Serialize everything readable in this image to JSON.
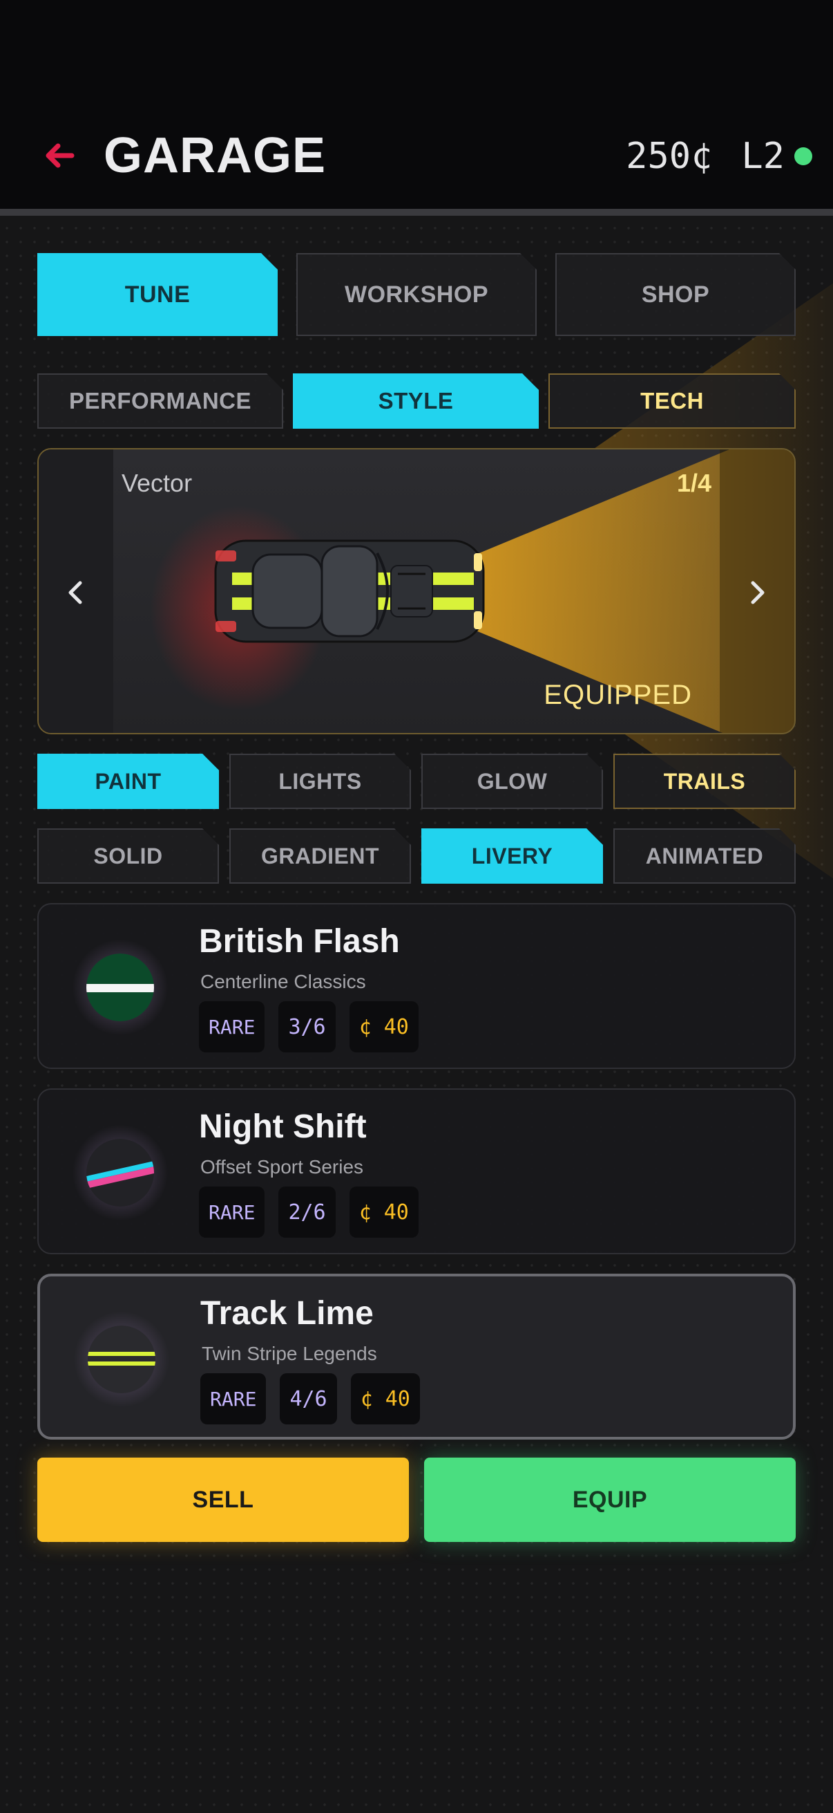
{
  "header": {
    "title": "GARAGE",
    "credits": "250¢",
    "level": "L2",
    "status_color": "#4ade80",
    "back_icon": "arrow-left-icon",
    "accent": "#e11d48"
  },
  "main_tabs": [
    {
      "label": "TUNE",
      "active": true
    },
    {
      "label": "WORKSHOP",
      "active": false
    },
    {
      "label": "SHOP",
      "active": false
    }
  ],
  "sub_tabs": [
    {
      "label": "PERFORMANCE",
      "active": false
    },
    {
      "label": "STYLE",
      "active": true
    },
    {
      "label": "TECH",
      "active": false
    }
  ],
  "preview": {
    "car_name": "Vector",
    "index": "1/4",
    "status": "EQUIPPED",
    "prev_icon": "chevron-left-icon",
    "next_icon": "chevron-right-icon"
  },
  "category_tabs": [
    {
      "label": "PAINT",
      "active": true
    },
    {
      "label": "LIGHTS",
      "active": false
    },
    {
      "label": "GLOW",
      "active": false
    },
    {
      "label": "TRAILS",
      "active": false
    }
  ],
  "pattern_tabs": [
    {
      "label": "SOLID",
      "active": false
    },
    {
      "label": "GRADIENT",
      "active": false
    },
    {
      "label": "LIVERY",
      "active": true
    },
    {
      "label": "ANIMATED",
      "active": false
    }
  ],
  "liveries": [
    {
      "name": "British Flash",
      "series": "Centerline Classics",
      "rarity": "RARE",
      "count": "3/6",
      "price": "¢ 40",
      "selected": false
    },
    {
      "name": "Night Shift",
      "series": "Offset Sport Series",
      "rarity": "RARE",
      "count": "2/6",
      "price": "¢ 40",
      "selected": false
    },
    {
      "name": "Track Lime",
      "series": "Twin Stripe Legends",
      "rarity": "RARE",
      "count": "4/6",
      "price": "¢ 40",
      "selected": true
    }
  ],
  "actions": {
    "sell_label": "SELL",
    "equip_label": "EQUIP"
  },
  "colors": {
    "active_tab": "#22d3ee",
    "sell": "#fbbf24",
    "equip": "#4ade80",
    "rarity": "#c4b5fd",
    "price": "#fbbf24"
  }
}
